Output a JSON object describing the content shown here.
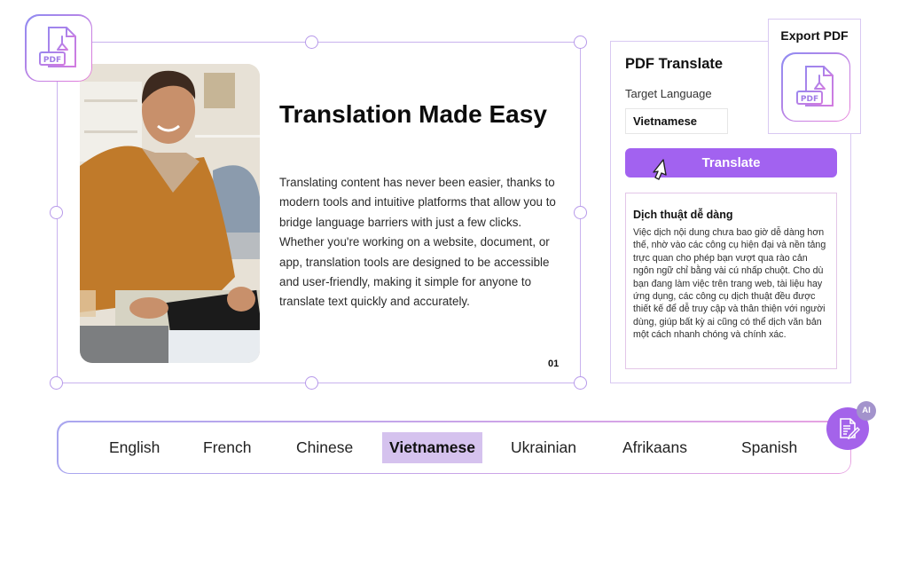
{
  "slide": {
    "title": "Translation Made Easy",
    "body": "Translating content has never been easier, thanks to modern tools and intuitive platforms that allow you to bridge language barriers with just a few clicks. Whether you're working on a website, document, or app, translation tools are designed to be accessible and user-friendly, making it simple for anyone to translate text quickly and accurately.",
    "page_number": "01",
    "photo_icon": "photo-of-smiling-man-at-desk"
  },
  "icons": {
    "pdf_icon_label": "PDF",
    "pdf_file": "pdf-file-icon",
    "ai_doc": "document-edit-icon",
    "cursor": "mouse-pointer-icon"
  },
  "panel": {
    "title": "PDF Translate",
    "target_label": "Target Language",
    "target_value": "Vietnamese",
    "translate_label": "Translate",
    "result_title": "Dịch thuật dễ dàng",
    "result_body": "Việc dịch nội dung chưa bao giờ dễ dàng hơn thế, nhờ vào các công cụ hiện đại và nền tảng trực quan cho phép bạn vượt qua rào cản ngôn ngữ chỉ bằng vài cú nhấp chuột. Cho dù bạn đang làm việc trên trang web, tài liệu hay ứng dụng, các công cụ dịch thuật đều được thiết kế để dễ truy cập và thân thiện với người dùng, giúp bất kỳ ai cũng có thể dịch văn bản một cách nhanh chóng và chính xác."
  },
  "export": {
    "label": "Export PDF"
  },
  "languages": {
    "selected": "Vietnamese",
    "items": [
      "English",
      "French",
      "Chinese",
      "Vietnamese",
      "Ukrainian",
      "Afrikaans",
      "Spanish"
    ]
  },
  "ai": {
    "badge": "AI"
  },
  "colors": {
    "accent": "#a262f0",
    "selected_language_bg": "#d5c2ee",
    "frame": "#c9b2ee",
    "icon_gradient_start": "#8f8cf2",
    "icon_gradient_end": "#e77bd9"
  }
}
